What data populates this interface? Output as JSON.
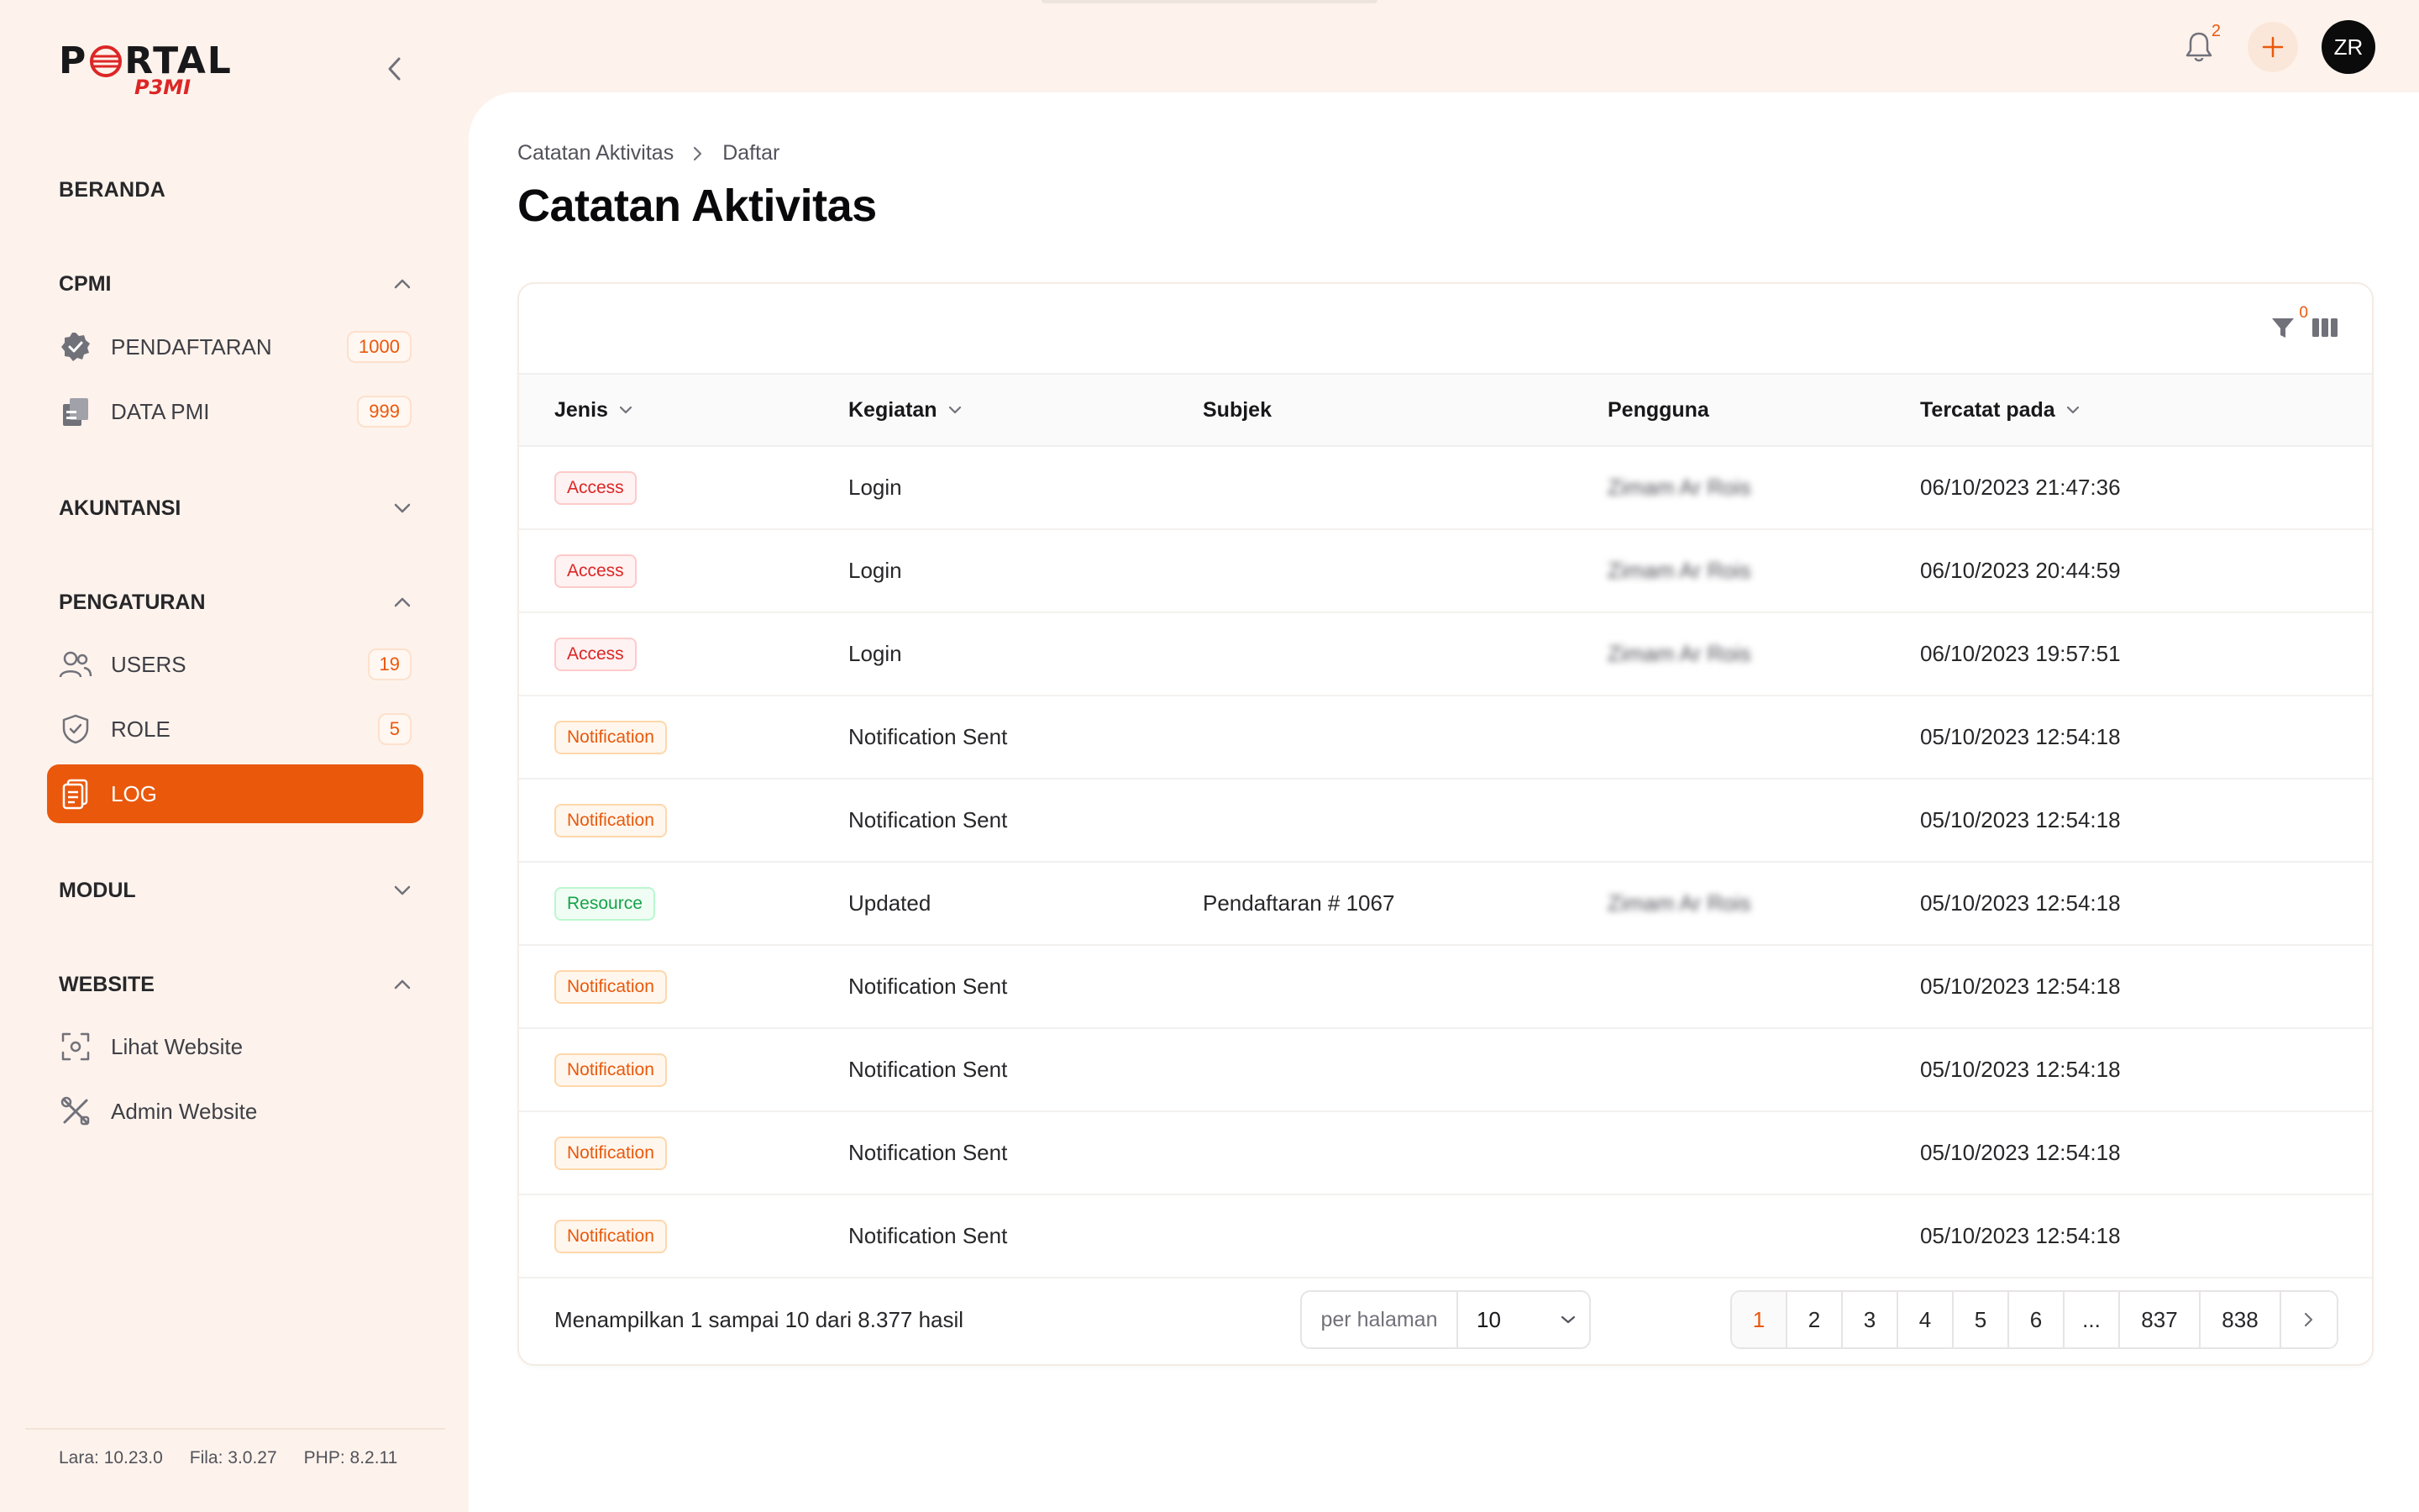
{
  "brand": {
    "logo_main_left": "P",
    "logo_main_right": "RTAL",
    "logo_sub": "P3MI"
  },
  "sidebar": {
    "home": "BERANDA",
    "groups": [
      {
        "label": "CPMI",
        "expanded": true
      },
      {
        "label": "AKUNTANSI",
        "expanded": false
      },
      {
        "label": "PENGATURAN",
        "expanded": true
      },
      {
        "label": "MODUL",
        "expanded": false
      },
      {
        "label": "WEBSITE",
        "expanded": true
      }
    ],
    "items": [
      {
        "label": "PENDAFTARAN",
        "badge": "1000",
        "icon": "verified-badge-icon"
      },
      {
        "label": "DATA PMI",
        "badge": "999",
        "icon": "documents-icon"
      },
      {
        "label": "USERS",
        "badge": "19",
        "icon": "users-icon"
      },
      {
        "label": "ROLE",
        "badge": "5",
        "icon": "shield-check-icon"
      },
      {
        "label": "LOG",
        "badge": "",
        "icon": "clipboard-icon",
        "active": true
      },
      {
        "label": "Lihat Website",
        "badge": "",
        "icon": "viewfinder-icon"
      },
      {
        "label": "Admin Website",
        "badge": "",
        "icon": "tools-icon"
      }
    ],
    "versions": [
      "Lara: 10.23.0",
      "Fila: 3.0.27",
      "PHP: 8.2.11"
    ]
  },
  "topbar": {
    "notifications": "2",
    "avatar_initials": "ZR"
  },
  "breadcrumb": [
    "Catatan Aktivitas",
    "Daftar"
  ],
  "page_title": "Catatan Aktivitas",
  "toolbar": {
    "filter_count": "0"
  },
  "table": {
    "columns": [
      "Jenis",
      "Kegiatan",
      "Subjek",
      "Pengguna",
      "Tercatat pada"
    ],
    "rows": [
      {
        "jenis": "Access",
        "kind": "access",
        "kegiatan": "Login",
        "subjek": "",
        "pengguna": "Zimam Ar Rois",
        "tercatat": "06/10/2023 21:47:36"
      },
      {
        "jenis": "Access",
        "kind": "access",
        "kegiatan": "Login",
        "subjek": "",
        "pengguna": "Zimam Ar Rois",
        "tercatat": "06/10/2023 20:44:59"
      },
      {
        "jenis": "Access",
        "kind": "access",
        "kegiatan": "Login",
        "subjek": "",
        "pengguna": "Zimam Ar Rois",
        "tercatat": "06/10/2023 19:57:51"
      },
      {
        "jenis": "Notification",
        "kind": "notification",
        "kegiatan": "Notification Sent",
        "subjek": "",
        "pengguna": "",
        "tercatat": "05/10/2023 12:54:18"
      },
      {
        "jenis": "Notification",
        "kind": "notification",
        "kegiatan": "Notification Sent",
        "subjek": "",
        "pengguna": "",
        "tercatat": "05/10/2023 12:54:18"
      },
      {
        "jenis": "Resource",
        "kind": "resource",
        "kegiatan": "Updated",
        "subjek": "Pendaftaran # 1067",
        "pengguna": "Zimam Ar Rois",
        "tercatat": "05/10/2023 12:54:18"
      },
      {
        "jenis": "Notification",
        "kind": "notification",
        "kegiatan": "Notification Sent",
        "subjek": "",
        "pengguna": "",
        "tercatat": "05/10/2023 12:54:18"
      },
      {
        "jenis": "Notification",
        "kind": "notification",
        "kegiatan": "Notification Sent",
        "subjek": "",
        "pengguna": "",
        "tercatat": "05/10/2023 12:54:18"
      },
      {
        "jenis": "Notification",
        "kind": "notification",
        "kegiatan": "Notification Sent",
        "subjek": "",
        "pengguna": "",
        "tercatat": "05/10/2023 12:54:18"
      },
      {
        "jenis": "Notification",
        "kind": "notification",
        "kegiatan": "Notification Sent",
        "subjek": "",
        "pengguna": "",
        "tercatat": "05/10/2023 12:54:18"
      }
    ]
  },
  "footer": {
    "result_text": "Menampilkan 1 sampai 10 dari 8.377 hasil",
    "per_page_label": "per halaman",
    "per_page_value": "10",
    "pages": [
      "1",
      "2",
      "3",
      "4",
      "5",
      "6",
      "...",
      "837",
      "838"
    ],
    "current_page": "1"
  },
  "colors": {
    "accent": "#ea580c",
    "sidebar_bg": "#fdf3ec",
    "access": "#dc2626",
    "resource": "#16a34a"
  }
}
